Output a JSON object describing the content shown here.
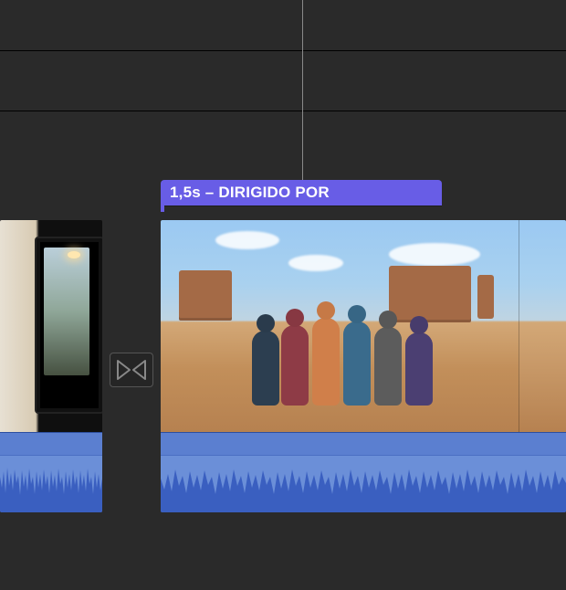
{
  "callout": {},
  "title_clip": {
    "label": "1,5s – DIRIGIDO POR",
    "duration_text": "1,5s",
    "title_text": "DIRIGIDO POR",
    "accent_color": "#685de6"
  },
  "timeline": {
    "clips": [
      {
        "name": "clip-left"
      },
      {
        "name": "clip-right"
      }
    ],
    "transition": {
      "name": "cross-dissolve"
    }
  }
}
